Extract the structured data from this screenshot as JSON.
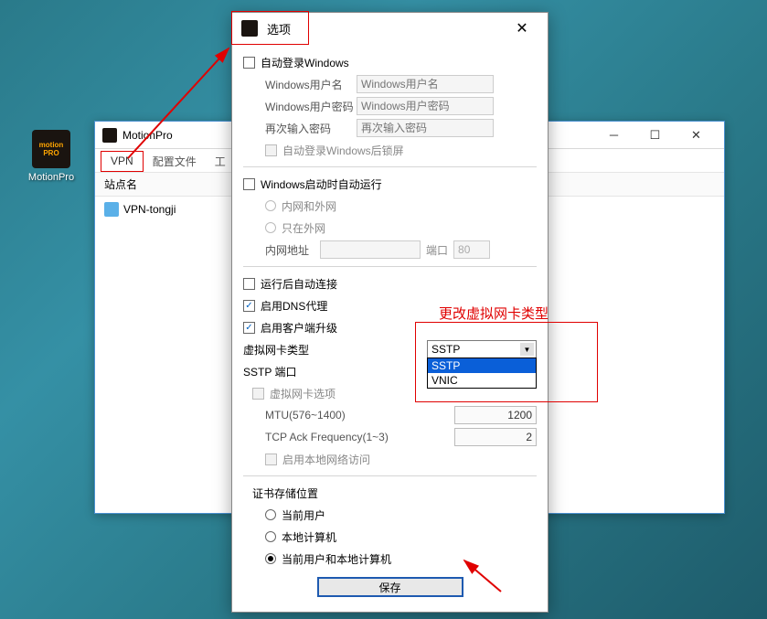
{
  "desktop": {
    "icon_label": "MotionPro",
    "icon_text": "motion PRO"
  },
  "main_window": {
    "title": "MotionPro",
    "menu": {
      "vpn": "VPN",
      "config": "配置文件",
      "tools": "工"
    },
    "column_header": "站点名",
    "site_item": "VPN-tongji"
  },
  "options": {
    "title": "选项",
    "auto_login_windows": "自动登录Windows",
    "win_user_label": "Windows用户名",
    "win_user_placeholder": "Windows用户名",
    "win_pwd_label": "Windows用户密码",
    "win_pwd_placeholder": "Windows用户密码",
    "reenter_pwd_label": "再次输入密码",
    "reenter_pwd_placeholder": "再次输入密码",
    "lock_after_login": "自动登录Windows后锁屏",
    "auto_run_startup": "Windows启动时自动运行",
    "net_both": "内网和外网",
    "net_ext_only": "只在外网",
    "intranet_addr": "内网地址",
    "port_label": "端口",
    "port_value": "80",
    "auto_connect": "运行后自动连接",
    "enable_dns": "启用DNS代理",
    "enable_client_upgrade": "启用客户端升级",
    "vnic_type_label": "虚拟网卡类型",
    "sstp_port_label": "SSTP 端口",
    "vnic_options_label": "虚拟网卡选项",
    "mtu_label": "MTU(576~1400)",
    "mtu_value": "1200",
    "tcp_ack_label": "TCP Ack Frequency(1~3)",
    "tcp_ack_value": "2",
    "enable_local_net": "启用本地网络访问",
    "cert_store_label": "证书存储位置",
    "cert_current_user": "当前用户",
    "cert_local_machine": "本地计算机",
    "cert_both": "当前用户和本地计算机",
    "dropdown": {
      "selected": "SSTP",
      "opt1": "SSTP",
      "opt2": "VNIC"
    },
    "save_button": "保存"
  },
  "annotations": {
    "change_vnic": "更改虚拟网卡类型"
  }
}
